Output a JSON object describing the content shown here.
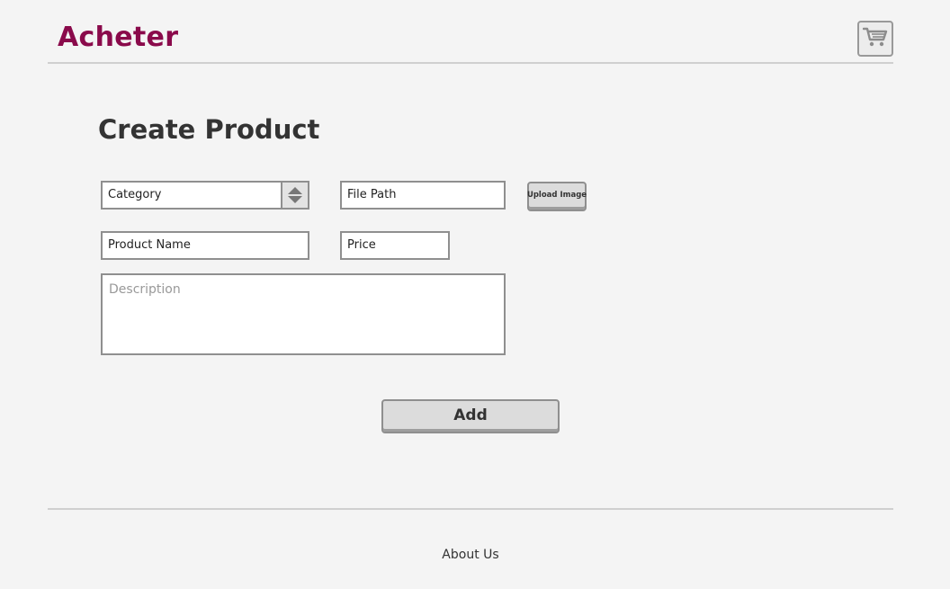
{
  "header": {
    "brand": "Acheter",
    "cart_icon": "shopping-cart-icon",
    "brand_color": "#8a0a4b"
  },
  "main": {
    "title": "Create Product",
    "category_select": {
      "value": "Category"
    },
    "file_path": {
      "value": "File Path"
    },
    "upload_button": "Upload Image",
    "product_name": {
      "value": "Product Name"
    },
    "price": {
      "value": "Price"
    },
    "description": {
      "placeholder": "Description"
    },
    "add_button": "Add"
  },
  "footer": {
    "about_link": "About Us"
  }
}
